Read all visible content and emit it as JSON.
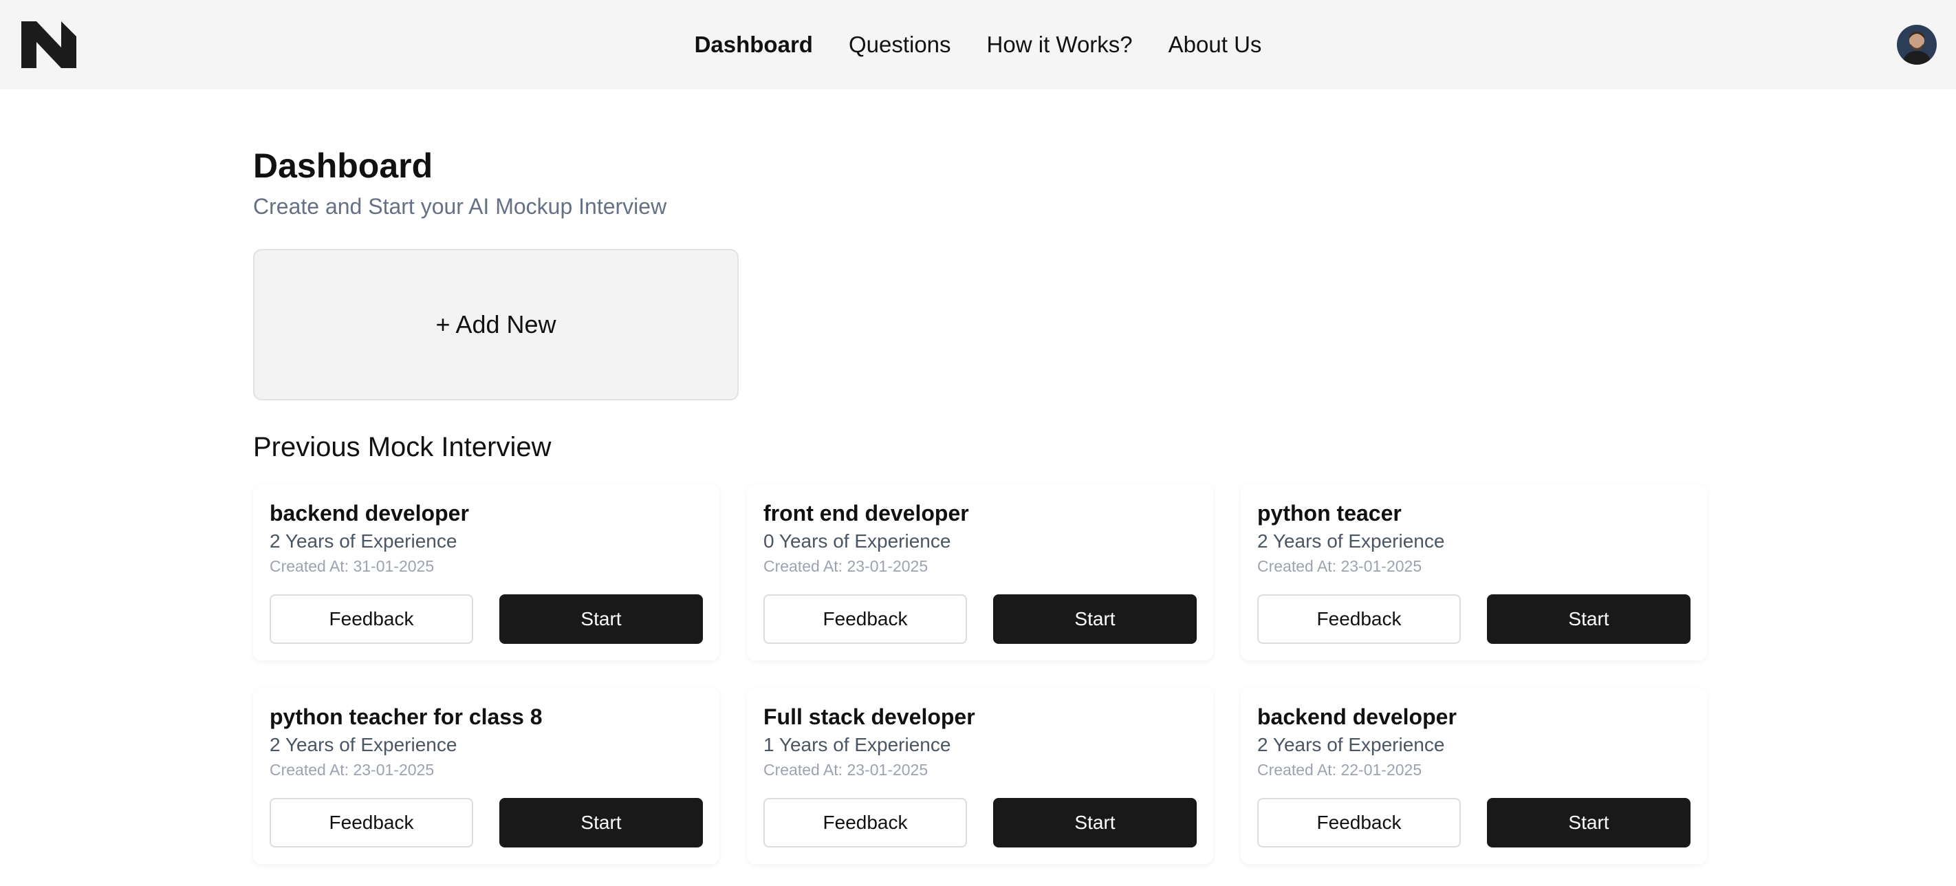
{
  "header": {
    "logo": "N-logo-icon",
    "nav": [
      {
        "label": "Dashboard",
        "active": true
      },
      {
        "label": "Questions",
        "active": false
      },
      {
        "label": "How it Works?",
        "active": false
      },
      {
        "label": "About Us",
        "active": false
      }
    ],
    "avatar": "user-avatar"
  },
  "main": {
    "title": "Dashboard",
    "subtitle": "Create and Start your AI Mockup Interview",
    "add_new_label": "+ Add New",
    "section_title": "Previous Mock Interview",
    "interviews": [
      {
        "title": "backend developer",
        "experience": "2 Years of Experience",
        "created": "Created At: 31-01-2025",
        "feedback_label": "Feedback",
        "start_label": "Start"
      },
      {
        "title": "front end developer",
        "experience": "0 Years of Experience",
        "created": "Created At: 23-01-2025",
        "feedback_label": "Feedback",
        "start_label": "Start"
      },
      {
        "title": "python teacer",
        "experience": "2 Years of Experience",
        "created": "Created At: 23-01-2025",
        "feedback_label": "Feedback",
        "start_label": "Start"
      },
      {
        "title": "python teacher for class 8",
        "experience": "2 Years of Experience",
        "created": "Created At: 23-01-2025",
        "feedback_label": "Feedback",
        "start_label": "Start"
      },
      {
        "title": "Full stack developer",
        "experience": "1 Years of Experience",
        "created": "Created At: 23-01-2025",
        "feedback_label": "Feedback",
        "start_label": "Start"
      },
      {
        "title": "backend developer",
        "experience": "2 Years of Experience",
        "created": "Created At: 22-01-2025",
        "feedback_label": "Feedback",
        "start_label": "Start"
      }
    ]
  },
  "colors": {
    "header_bg": "#f5f5f5",
    "primary_button": "#191919",
    "subtitle_text": "#667085",
    "add_new_bg": "#f3f3f3"
  }
}
